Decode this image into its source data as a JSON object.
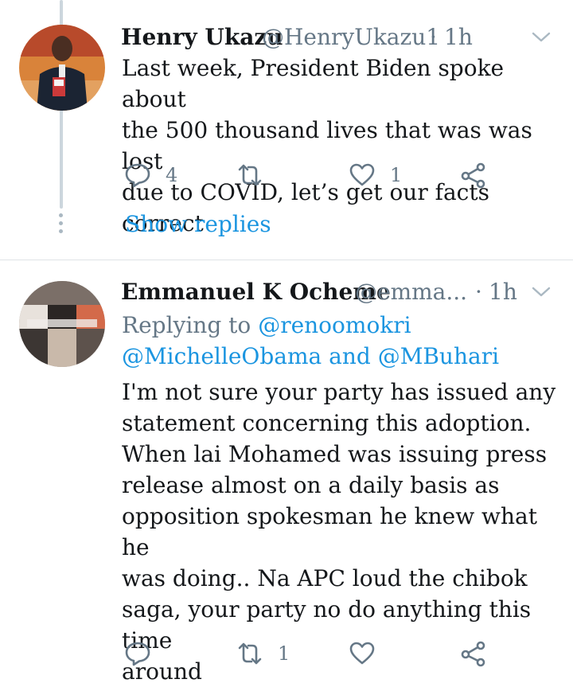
{
  "tweets": [
    {
      "name": "Henry Ukazu",
      "handle": "@HenryUkazu1",
      "dot": "·",
      "time": "1h",
      "text_lines": [
        "Last week, President Biden spoke about",
        "the 500 thousand lives that was was lost",
        "due to COVID, let’s get our facts correct"
      ],
      "replies": "4",
      "retweets": "",
      "likes": "1",
      "show_replies": "Show replies"
    },
    {
      "name": "Emmanuel K Ocheme",
      "handle": "@emma...",
      "dot": "·",
      "time": "1h",
      "replying_prefix": "Replying to",
      "replying_to_1": "@renoomokri",
      "replying_to_2": "@MichelleObama",
      "replying_and": "and",
      "replying_to_3": "@MBuhari",
      "text_lines": [
        "I'm not sure your party has issued any",
        "statement concerning this adoption.",
        "When lai Mohamed was issuing press",
        "release almost on a daily basis as",
        "opposition spokesman he knew what he",
        "was doing.. Na APC loud the chibok",
        "saga, your party no do anything this time",
        "around"
      ],
      "replies": "",
      "retweets": "1",
      "likes": ""
    }
  ],
  "icons": {
    "reply": "reply-icon",
    "retweet": "retweet-icon",
    "like": "heart-icon",
    "share": "share-icon",
    "menu": "chevron-down-icon"
  }
}
